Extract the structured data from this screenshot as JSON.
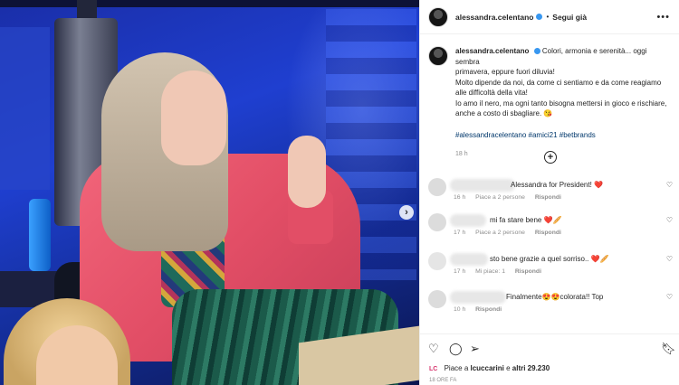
{
  "post": {
    "username": "alessandra.celentano",
    "follow_label": "Segui già",
    "more_icon": "more-horizontal-icon",
    "next_icon": "chevron-right-icon"
  },
  "caption": {
    "username": "alessandra.celentano",
    "lines": [
      "Colori, armonia e serenità... oggi sembra",
      "primavera, eppure fuori diluvia!",
      "Molto dipende da noi, da come ci sentiamo e da come reagiamo",
      "alle difficoltà della vita!",
      "Io amo il nero, ma ogni tanto bisogna mettersi in gioco e rischiare,",
      "anche a costo di sbagliare. 😘"
    ],
    "hashtags": "#alessandracelentano #amici21 #betbrands",
    "time": "18 h"
  },
  "comments": [
    {
      "text": "Alessandra for President! ❤️",
      "time": "16 h",
      "likes": "Piace a 2 persone",
      "reply": "Rispondi"
    },
    {
      "text": "mi fa stare bene ❤️🥖",
      "time": "17 h",
      "likes": "Piace a 2 persone",
      "reply": "Rispondi"
    },
    {
      "text": "sto bene grazie a quel sorriso.. ❤️🥖",
      "time": "17 h",
      "likes": "Mi piace: 1",
      "reply": "Rispondi"
    },
    {
      "text": "Finalmente😍😍colorata!! Top",
      "time": "10 h",
      "likes": "",
      "reply": "Rispondi"
    }
  ],
  "actions": {
    "like_icon": "heart-icon",
    "comment_icon": "comment-icon",
    "share_icon": "send-icon",
    "save_icon": "bookmark-icon"
  },
  "likes": {
    "badge": "LC",
    "prefix": "Piace a",
    "user": "lcuccarini",
    "connector": "e",
    "others": "altri 29.230"
  },
  "date": "18 ORE FA"
}
